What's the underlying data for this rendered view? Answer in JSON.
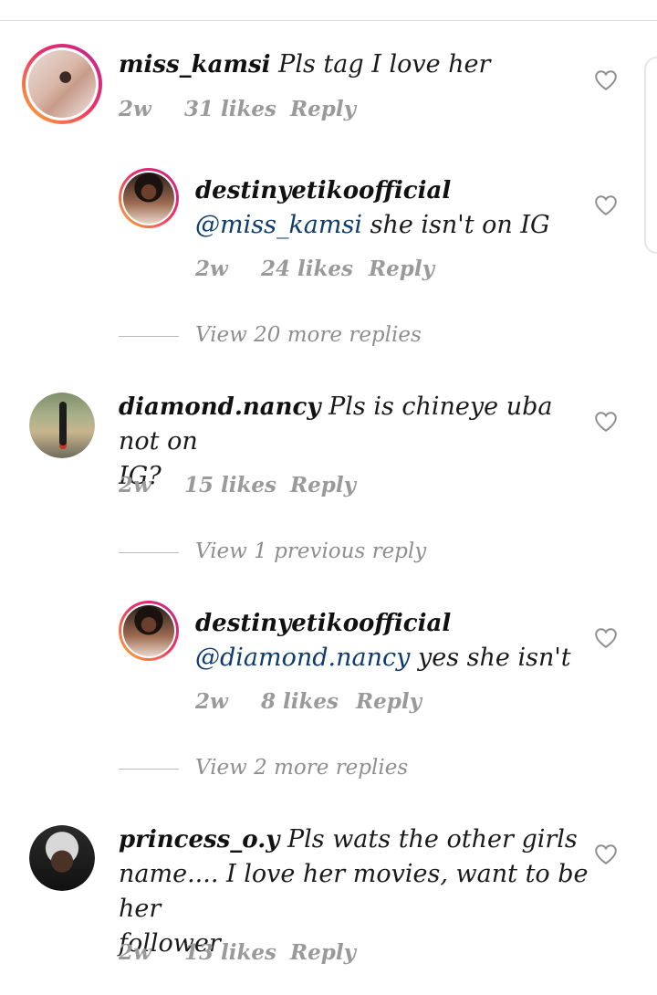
{
  "comments": [
    {
      "username": "miss_kamsi",
      "text": "Pls tag I love her",
      "mention": "",
      "time": "2w",
      "likes": "31 likes",
      "reply": "Reply"
    },
    {
      "username": "destinyetikoofficial",
      "text": "she isn't on IG",
      "mention": "@miss_kamsi",
      "time": "2w",
      "likes": "24 likes",
      "reply": "Reply"
    },
    {
      "username": "diamond.nancy",
      "text": "Pls is chineye uba not on",
      "text2": "IG?",
      "mention": "",
      "time": "2w",
      "likes": "15 likes",
      "reply": "Reply"
    },
    {
      "username": "destinyetikoofficial",
      "text": "yes she isn't",
      "mention": "@diamond.nancy",
      "time": "2w",
      "likes": "8 likes",
      "reply": "Reply"
    },
    {
      "username": "princess_o.y",
      "text": "Pls wats the other girls",
      "text2": "name.... I love her movies, want to be her",
      "text3": "follower",
      "mention": "",
      "time": "2w",
      "likes": "13 likes",
      "reply": "Reply"
    }
  ],
  "view_more": [
    "View 20 more replies",
    "View 1 previous reply",
    "View 2 more replies"
  ],
  "icons": {
    "like": "heart-outline-icon"
  },
  "colors": {
    "mention": "#0d3b6e",
    "meta": "#9a9a9a",
    "story_ring": [
      "#f9b234",
      "#ef2e67",
      "#bc2a8d"
    ]
  }
}
